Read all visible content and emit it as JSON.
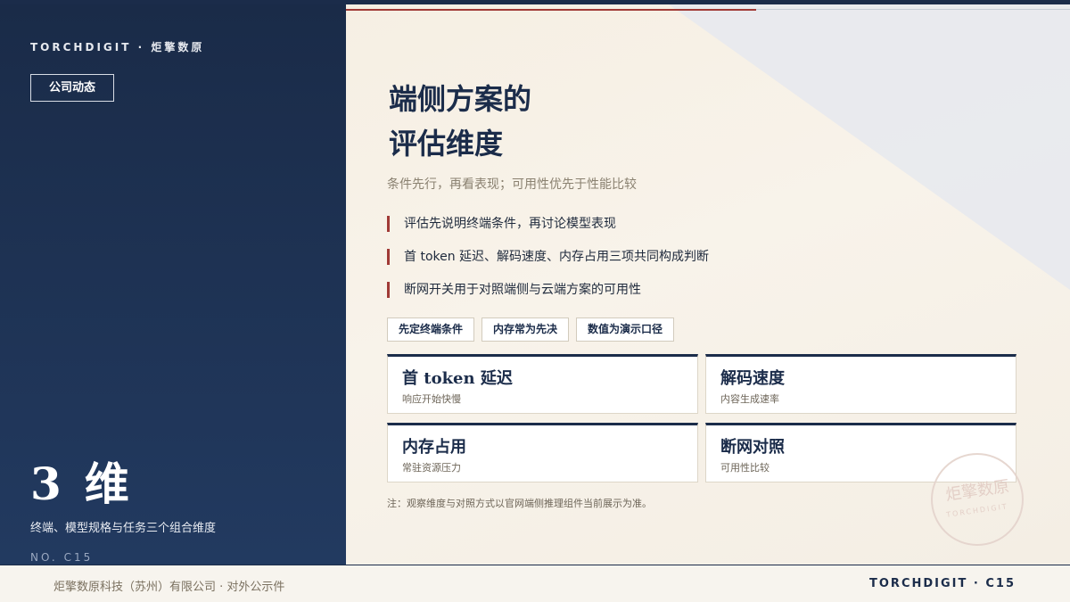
{
  "colors": {
    "navy": "#1b2c4a",
    "accent_red": "#a03a36",
    "cream": "#f6efe3"
  },
  "brand": {
    "line": "TORCHDIGIT · 炬擎数原"
  },
  "section_tag": "公司动态",
  "left": {
    "big_number": "3",
    "big_unit": "维",
    "caption": "终端、模型规格与任务三个组合维度",
    "code": "NO. C15"
  },
  "main": {
    "title_line1": "端侧方案的",
    "title_line2": "评估维度",
    "subtitle": "条件先行，再看表现；可用性优先于性能比较",
    "bullets": [
      "评估先说明终端条件，再讨论模型表现",
      "首 token 延迟、解码速度、内存占用三项共同构成判断",
      "断网开关用于对照端侧与云端方案的可用性"
    ],
    "tags": [
      "先定终端条件",
      "内存常为先决",
      "数值为演示口径"
    ],
    "cards": [
      {
        "title": "首 token 延迟",
        "sub": "响应开始快慢"
      },
      {
        "title": "解码速度",
        "sub": "内容生成速率"
      },
      {
        "title": "内存占用",
        "sub": "常驻资源压力"
      },
      {
        "title": "断网对照",
        "sub": "可用性比较"
      }
    ],
    "note": "注：观察维度与对照方式以官网端侧推理组件当前展示为准。"
  },
  "stamp": {
    "cn": "炬擎数原",
    "en": "TORCHDIGIT"
  },
  "footer": {
    "left": "炬擎数原科技（苏州）有限公司 · 对外公示件",
    "right": "TORCHDIGIT · C15"
  }
}
